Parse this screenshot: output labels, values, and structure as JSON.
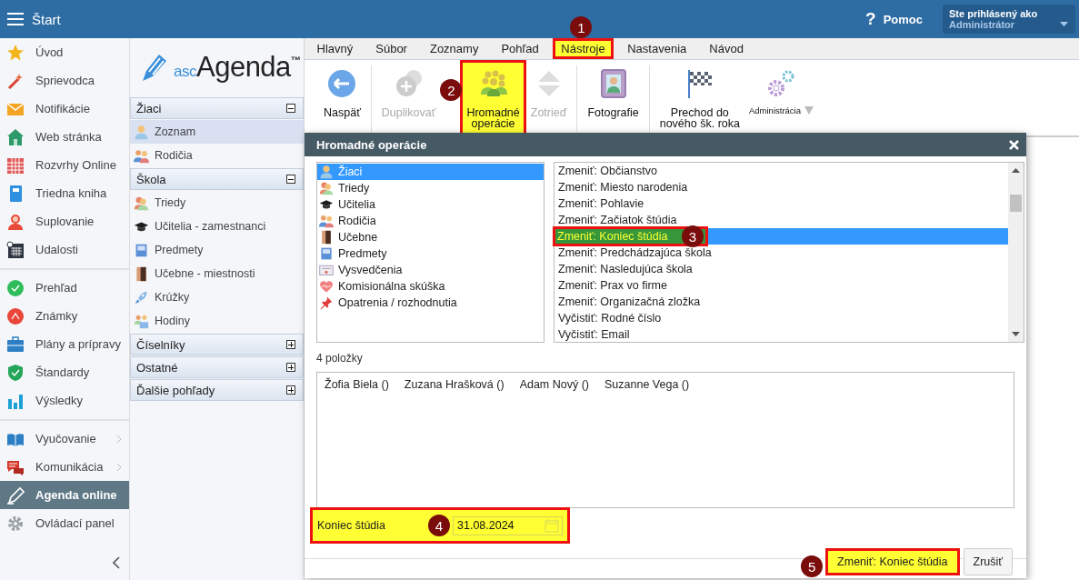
{
  "top_bar": {
    "title": "Štart",
    "help": {
      "icon": "?",
      "label": "Pomoc"
    },
    "user": {
      "caption": "Ste prihlásený ako",
      "name": "Administrátor"
    }
  },
  "sidebar": {
    "sections": [
      {
        "items": [
          {
            "label": "Úvod",
            "selected": false,
            "submenu": false
          },
          {
            "label": "Sprievodca",
            "selected": false,
            "submenu": false
          },
          {
            "label": "Notifikácie",
            "selected": false,
            "submenu": false
          },
          {
            "label": "Web stránka",
            "selected": false,
            "submenu": false
          },
          {
            "label": "Rozvrhy Online",
            "selected": false,
            "submenu": false
          },
          {
            "label": "Triedna kniha",
            "selected": false,
            "submenu": false
          },
          {
            "label": "Suplovanie",
            "selected": false,
            "submenu": false
          },
          {
            "label": "Udalosti",
            "selected": false,
            "submenu": false
          }
        ]
      },
      {
        "items": [
          {
            "label": "Prehľad",
            "selected": false,
            "submenu": false
          },
          {
            "label": "Známky",
            "selected": false,
            "submenu": false
          },
          {
            "label": "Plány a prípravy",
            "selected": false,
            "submenu": false
          },
          {
            "label": "Štandardy",
            "selected": false,
            "submenu": false
          },
          {
            "label": "Výsledky",
            "selected": false,
            "submenu": false
          }
        ]
      },
      {
        "items": [
          {
            "label": "Vyučovanie",
            "selected": false,
            "submenu": true
          },
          {
            "label": "Komunikácia",
            "selected": false,
            "submenu": true
          },
          {
            "label": "Agenda online",
            "selected": true,
            "submenu": false
          },
          {
            "label": "Ovládací panel",
            "selected": false,
            "submenu": false
          }
        ]
      }
    ]
  },
  "nav": {
    "logo": {
      "prefix": "asc",
      "name": "Agenda",
      "mark": "™"
    },
    "sections": [
      {
        "title": "Žiaci",
        "expanded": true,
        "items": [
          {
            "label": "Zoznam",
            "selected": true
          },
          {
            "label": "Rodičia",
            "selected": false
          }
        ]
      },
      {
        "title": "Škola",
        "expanded": true,
        "items": [
          {
            "label": "Triedy",
            "selected": false
          },
          {
            "label": "Učitelia - zamestnanci",
            "selected": false
          },
          {
            "label": "Predmety",
            "selected": false
          },
          {
            "label": "Učebne - miestnosti",
            "selected": false
          },
          {
            "label": "Krúžky",
            "selected": false
          },
          {
            "label": "Hodiny",
            "selected": false
          }
        ]
      },
      {
        "title": "Číselníky",
        "expanded": false
      },
      {
        "title": "Ostatné",
        "expanded": false
      },
      {
        "title": "Ďalšie pohľady",
        "expanded": false
      }
    ]
  },
  "menu_tabs": [
    {
      "label": "Hlavný",
      "highlighted": false
    },
    {
      "label": "Súbor",
      "highlighted": false
    },
    {
      "label": "Zoznamy",
      "highlighted": false
    },
    {
      "label": "Pohľad",
      "highlighted": false
    },
    {
      "label": "Nástroje",
      "highlighted": true,
      "marker": "1"
    },
    {
      "label": "Nastavenia",
      "highlighted": false
    },
    {
      "label": "Návod",
      "highlighted": false
    }
  ],
  "ribbon": {
    "groups": [
      {
        "buttons": [
          {
            "kind": "button",
            "label": "Naspäť",
            "disabled": false,
            "highlighted": false
          }
        ]
      },
      {
        "buttons": [
          {
            "kind": "button",
            "label": "Duplikovať",
            "disabled": true,
            "highlighted": false
          },
          {
            "kind": "button",
            "label": "Hromadné\noperácie",
            "disabled": false,
            "highlighted": true,
            "marker": "2"
          },
          {
            "kind": "button",
            "label": "Zotrieď",
            "disabled": true,
            "highlighted": false
          }
        ]
      },
      {
        "buttons": [
          {
            "kind": "button",
            "label": "Fotografie",
            "disabled": false,
            "highlighted": false
          }
        ]
      },
      {
        "buttons": [
          {
            "kind": "button",
            "label": "Prechod do\nnového šk. roka",
            "disabled": false,
            "highlighted": false
          },
          {
            "kind": "menu",
            "label": "Administrácia",
            "disabled": false,
            "highlighted": false
          }
        ]
      }
    ]
  },
  "dialog": {
    "title": "Hromadné operácie",
    "entities": [
      {
        "label": "Žiaci",
        "selected": true
      },
      {
        "label": "Triedy",
        "selected": false
      },
      {
        "label": "Učitelia",
        "selected": false
      },
      {
        "label": "Rodičia",
        "selected": false
      },
      {
        "label": "Učebne",
        "selected": false
      },
      {
        "label": "Predmety",
        "selected": false
      },
      {
        "label": "Vysvedčenia",
        "selected": false
      },
      {
        "label": "Komisionálna skúška",
        "selected": false
      },
      {
        "label": "Opatrenia / rozhodnutia",
        "selected": false
      }
    ],
    "operations": [
      {
        "label": "Zmeniť: Občianstvo",
        "selected": false,
        "highlighted": false
      },
      {
        "label": "Zmeniť: Miesto narodenia",
        "selected": false,
        "highlighted": false
      },
      {
        "label": "Zmeniť: Pohlavie",
        "selected": false,
        "highlighted": false
      },
      {
        "label": "Zmeniť: Začiatok štúdia",
        "selected": false,
        "highlighted": false
      },
      {
        "label": "Zmeniť: Koniec štúdia",
        "selected": true,
        "highlighted": true,
        "marker": "3"
      },
      {
        "label": "Zmeniť: Predchádzajúca škola",
        "selected": false,
        "highlighted": false
      },
      {
        "label": "Zmeniť: Nasledujúca škola",
        "selected": false,
        "highlighted": false
      },
      {
        "label": "Zmeniť: Prax vo firme",
        "selected": false,
        "highlighted": false
      },
      {
        "label": "Zmeniť: Organizačná zložka",
        "selected": false,
        "highlighted": false
      },
      {
        "label": "Vyčistiť: Rodné číslo",
        "selected": false,
        "highlighted": false
      },
      {
        "label": "Vyčistiť: Email",
        "selected": false,
        "highlighted": false
      }
    ],
    "count": "4 položky",
    "records": [
      "Žofia Biela ()",
      "Zuzana Hrašková ()",
      "Adam Nový ()",
      "Suzanne Vega ()"
    ],
    "field": {
      "label": "Koniec štúdia",
      "value": "31.08.2024",
      "highlighted": true,
      "marker": "4"
    },
    "buttons": [
      {
        "label": "Zmeniť: Koniec štúdia",
        "highlighted": true,
        "marker": "5"
      },
      {
        "label": "Zrušiť",
        "highlighted": false
      }
    ]
  }
}
